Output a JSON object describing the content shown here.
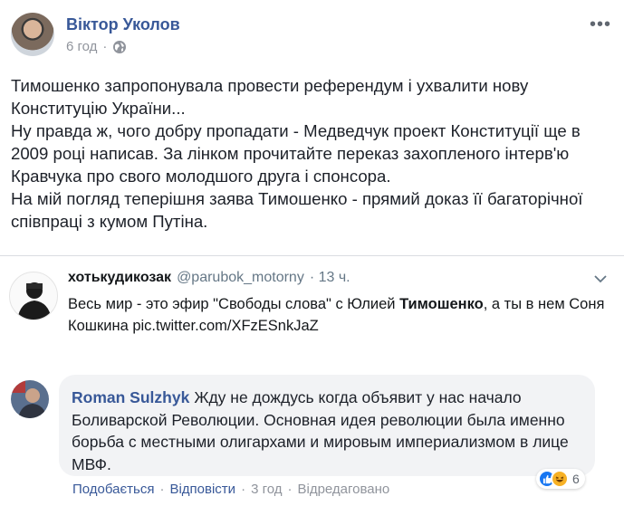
{
  "post": {
    "author": "Віктор Уколов",
    "time": "6 год",
    "privacy_icon": "globe-icon",
    "paragraphs": [
      "Тимошенко запропонувала провести референдум і ухвалити нову Конституцію України...",
      "Ну правда ж, чого добру пропадати - Медведчук проект Конституції ще в 2009 році написав. За лінком прочитайте переказ захопленого інтерв'ю Кравчука про свого молодшого друга і спонсора.",
      "На мій погляд теперішня заява Тимошенко - прямий доказ її багаторічної співпраці з кумом Путіна."
    ]
  },
  "tweet": {
    "name": "хотькудикозак",
    "handle": "@parubok_motorny",
    "time": "· 13 ч.",
    "text_before": "Весь мир - это эфир \"Свободы слова\" с Юлией ",
    "text_bold": "Тимошенко",
    "text_after": ", а ты в нем Соня Кошкина pic.twitter.com/XFzESnkJaZ"
  },
  "comment": {
    "author": "Roman Sulzhyk",
    "text": "Жду не дождусь когда объявит у нас начало Боливарской Революции. Основная идея революции была именно борьба с местными олигархами и мировым империализмом в лице МВФ.",
    "reactions_count": "6",
    "actions": {
      "like": "Подобається",
      "reply": "Відповісти",
      "time": "3 год",
      "edited": "Відредаговано",
      "sep": "·"
    }
  },
  "colors": {
    "link": "#385898",
    "meta": "#90949c",
    "bubble": "#f2f3f5"
  }
}
